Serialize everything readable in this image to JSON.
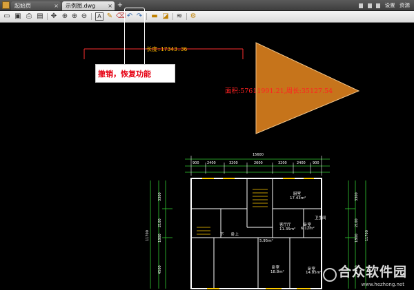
{
  "tabs": [
    {
      "label": "起始页",
      "close": "×"
    },
    {
      "label": "示例图.dwg",
      "close": "×"
    }
  ],
  "tab_add": "+",
  "topright": {
    "settings": "设置",
    "resources": "资源"
  },
  "toolbar": {
    "icons": [
      "open-folder-icon",
      "save-icon",
      "print-icon",
      "export-icon",
      "pan-icon",
      "zoom-window-icon",
      "zoom-in-icon",
      "zoom-out-icon",
      "text-icon",
      "pencil-icon",
      "eraser-icon",
      "undo-icon",
      "redo-icon",
      "measure-distance-icon",
      "measure-area-icon",
      "layers-icon",
      "settings-tool-icon"
    ]
  },
  "callout": {
    "text": "撤销，恢复功能"
  },
  "measurements": {
    "length_label": "长度:17343.36",
    "area_label": "面积:57611991.21,周长:35127.54"
  },
  "colors": {
    "triangle_fill": "#c6741b",
    "dimension_line": "#ff3030",
    "plan_green": "#33cc33",
    "callout_text": "#e60012"
  },
  "floorplan": {
    "top_total": "15600",
    "top_dims": [
      "900",
      "2400",
      "3200",
      "2600",
      "3200",
      "2400",
      "900"
    ],
    "left_total": "11700",
    "right_total": "11700",
    "left_dims": [
      "3300",
      "2100",
      "1800",
      "4500"
    ],
    "right_dims": [
      "3300",
      "2100",
      "1800",
      "4500"
    ],
    "rooms": [
      {
        "name": "厨室",
        "area": "17.43m²"
      },
      {
        "name": "客厅厅",
        "area": "11.35m²"
      },
      {
        "name": "卧上",
        "area": ""
      },
      {
        "name": "卧室",
        "area": "6.12m²"
      },
      {
        "name": "卫生间",
        "area": ""
      },
      {
        "name": "",
        "area": "5.95m²"
      },
      {
        "name": "卧室",
        "area": "18.8m²"
      },
      {
        "name": "卧室",
        "area": "14.85m²"
      },
      {
        "name": "下",
        "area": ""
      }
    ]
  },
  "watermark": {
    "text": "合众软件园",
    "url": "www.hezhong.net"
  }
}
